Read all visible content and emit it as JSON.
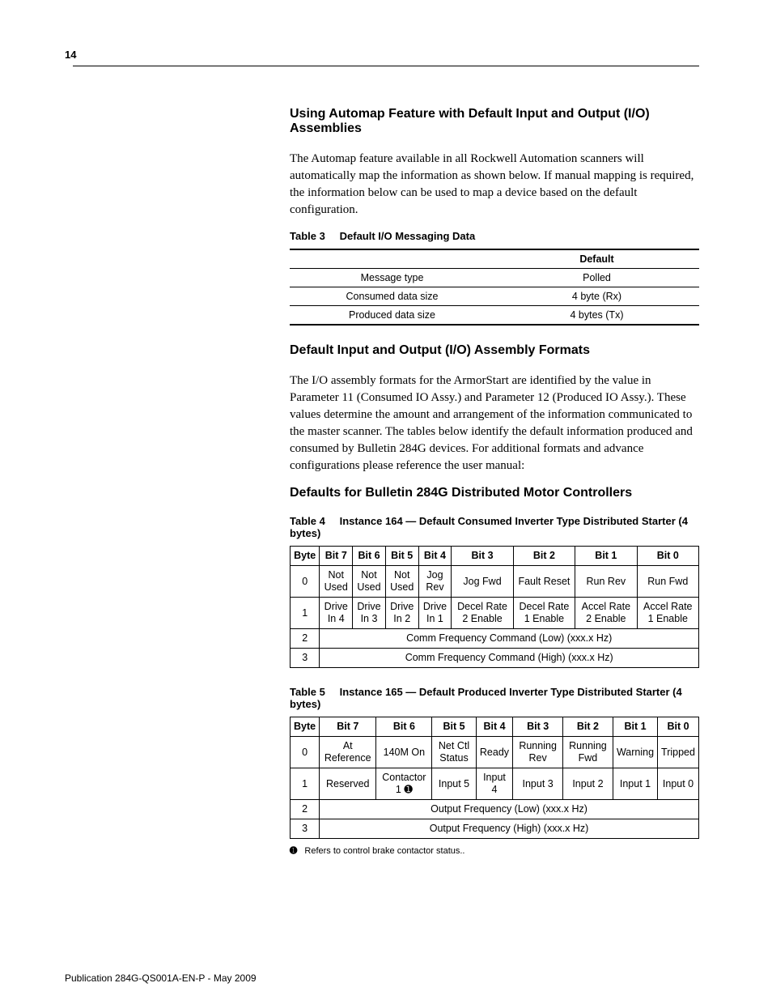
{
  "pageNumber": "14",
  "section1": {
    "h": "Using Automap Feature with Default Input and Output (I/O) Assemblies",
    "p": "The Automap feature available in all Rockwell Automation scanners will automatically map the information as shown below. If manual mapping is required, the information below can be used to map a device based on the default configuration."
  },
  "table3": {
    "caption_num": "Table 3",
    "caption_title": "Default I/O Messaging Data",
    "header_col2": "Default",
    "rows": [
      {
        "label": "Message type",
        "value": "Polled"
      },
      {
        "label": "Consumed data size",
        "value": "4 byte (Rx)"
      },
      {
        "label": "Produced data size",
        "value": "4 bytes (Tx)"
      }
    ]
  },
  "section2": {
    "h": "Default Input and Output (I/O) Assembly Formats",
    "p": "The I/O assembly formats for the ArmorStart are identified by the value in Parameter 11 (Consumed IO Assy.) and Parameter 12 (Produced IO Assy.). These values determine the amount and arrangement of the information communicated to the master scanner. The tables below identify the default information produced and consumed by Bulletin 284G devices. For additional formats and advance configurations please reference the user manual:"
  },
  "section3": {
    "h": "Defaults for Bulletin 284G Distributed Motor Controllers"
  },
  "table4": {
    "caption_num": "Table 4",
    "caption_title": "Instance 164 — Default Consumed Inverter Type Distributed Starter (4 bytes)",
    "headers": [
      "Byte",
      "Bit 7",
      "Bit 6",
      "Bit 5",
      "Bit 4",
      "Bit 3",
      "Bit 2",
      "Bit 1",
      "Bit 0"
    ],
    "row0": {
      "byte": "0",
      "b7": "Not Used",
      "b6": "Not Used",
      "b5": "Not Used",
      "b4": "Jog Rev",
      "b3": "Jog Fwd",
      "b2": "Fault Reset",
      "b1": "Run Rev",
      "b0": "Run Fwd"
    },
    "row1": {
      "byte": "1",
      "b7": "Drive In 4",
      "b6": "Drive In 3",
      "b5": "Drive In 2",
      "b4": "Drive In 1",
      "b3": "Decel Rate 2 Enable",
      "b2": "Decel Rate 1 Enable",
      "b1": "Accel Rate 2 Enable",
      "b0": "Accel Rate 1 Enable"
    },
    "row2": {
      "byte": "2",
      "span": "Comm Frequency Command (Low) (xxx.x Hz)"
    },
    "row3": {
      "byte": "3",
      "span": "Comm Frequency Command (High) (xxx.x Hz)"
    }
  },
  "table5": {
    "caption_num": "Table 5",
    "caption_title": "Instance 165 — Default Produced Inverter Type Distributed Starter (4 bytes)",
    "headers": [
      "Byte",
      "Bit 7",
      "Bit 6",
      "Bit 5",
      "Bit 4",
      "Bit 3",
      "Bit 2",
      "Bit 1",
      "Bit 0"
    ],
    "row0": {
      "byte": "0",
      "b7": "At Reference",
      "b6": "140M On",
      "b5": "Net Ctl Status",
      "b4": "Ready",
      "b3": "Running Rev",
      "b2": "Running Fwd",
      "b1": "Warning",
      "b0": "Tripped"
    },
    "row1": {
      "byte": "1",
      "b7": "Reserved",
      "b6": "Contactor 1 ➊",
      "b5": "Input 5",
      "b4": "Input 4",
      "b3": "Input 3",
      "b2": "Input 2",
      "b1": "Input 1",
      "b0": "Input 0"
    },
    "row2": {
      "byte": "2",
      "span": "Output Frequency (Low) (xxx.x Hz)"
    },
    "row3": {
      "byte": "3",
      "span": "Output Frequency (High) (xxx.x Hz)"
    }
  },
  "footnote": {
    "marker": "➊",
    "text": "Refers to control brake contactor status.."
  },
  "footer": "Publication 284G-QS001A-EN-P - May 2009"
}
